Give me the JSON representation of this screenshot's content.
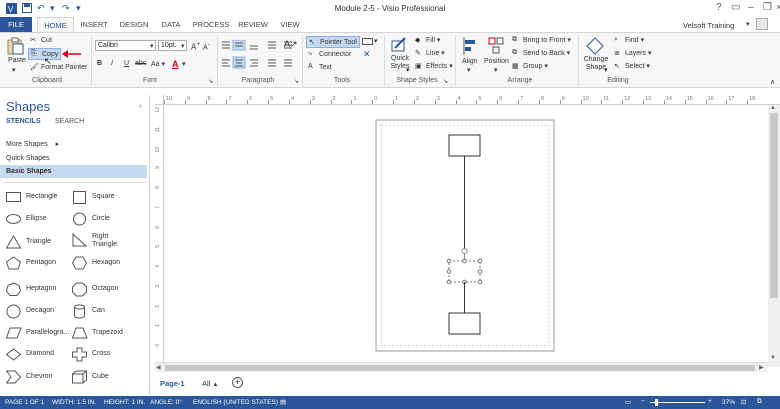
{
  "window": {
    "title": "Module 2-5 - Visio Professional"
  },
  "tabs": [
    "FILE",
    "HOME",
    "INSERT",
    "DESIGN",
    "DATA",
    "PROCESS",
    "REVIEW",
    "VIEW"
  ],
  "user": {
    "name": "Velsoft Training"
  },
  "ribbon": {
    "clipboard": {
      "paste": "Paste",
      "cut": "Cut",
      "copy": "Copy",
      "format_painter": "Format Painter",
      "label": "Clipboard"
    },
    "font": {
      "family": "Calibri",
      "size": "10pt.",
      "label": "Font",
      "bold": "B",
      "italic": "I",
      "underline": "U",
      "strike": "abc",
      "case": "Aa"
    },
    "paragraph": {
      "label": "Paragraph"
    },
    "tools": {
      "pointer": "Pointer Tool",
      "connector": "Connector",
      "text": "Text",
      "label": "Tools"
    },
    "shape_styles": {
      "quick_styles": "Quick Styles",
      "fill": "Fill",
      "line": "Line",
      "effects": "Effects",
      "label": "Shape Styles"
    },
    "arrange": {
      "align": "Align",
      "position": "Position",
      "bring_front": "Bring to Front",
      "send_back": "Send to Back",
      "group": "Group",
      "label": "Arrange"
    },
    "editing": {
      "change_shape": "Change Shape",
      "find": "Find",
      "layers": "Layers",
      "select": "Select",
      "label": "Editing"
    }
  },
  "shapes_pane": {
    "title": "Shapes",
    "tabs": [
      "STENCILS",
      "SEARCH"
    ],
    "items": [
      "More Shapes",
      "Quick Shapes",
      "Basic Shapes"
    ],
    "stencils": [
      [
        "Rectangle",
        "Square"
      ],
      [
        "Ellipse",
        "Circle"
      ],
      [
        "Triangle",
        "Right Triangle"
      ],
      [
        "Pentagon",
        "Hexagon"
      ],
      [
        "Heptagon",
        "Octagon"
      ],
      [
        "Decagon",
        "Can"
      ],
      [
        "Parallelogra...",
        "Trapezoid"
      ],
      [
        "Diamond",
        "Cross"
      ],
      [
        "Chevron",
        "Cube"
      ]
    ]
  },
  "ruler_top": [
    "10",
    "9",
    "8",
    "7",
    "6",
    "5",
    "4",
    "3",
    "2",
    "1",
    "0",
    "1",
    "2",
    "3",
    "4",
    "5",
    "6",
    "7",
    "8",
    "9",
    "10",
    "11",
    "12",
    "13",
    "14",
    "15",
    "16",
    "17",
    "18"
  ],
  "ruler_left": [
    "12",
    "11",
    "10",
    "9",
    "8",
    "7",
    "6",
    "5",
    "4",
    "3",
    "2",
    "1",
    "0"
  ],
  "page_tabs": {
    "page": "Page-1",
    "all": "All",
    "add": "+"
  },
  "status": {
    "page": "PAGE 1 OF 1",
    "width": "WIDTH: 1.5 IN.",
    "height": "HEIGHT: 1 IN.",
    "angle": "ANGLE: 0°",
    "language": "ENGLISH (UNITED STATES)",
    "zoom": "37%"
  },
  "colors": {
    "accent": "#2b579a",
    "arrow": "#d0021b"
  },
  "icons": [
    "visio-logo-icon",
    "save-icon",
    "undo-icon",
    "redo-icon",
    "help-icon",
    "minimize-icon",
    "restore-icon",
    "close-icon"
  ]
}
